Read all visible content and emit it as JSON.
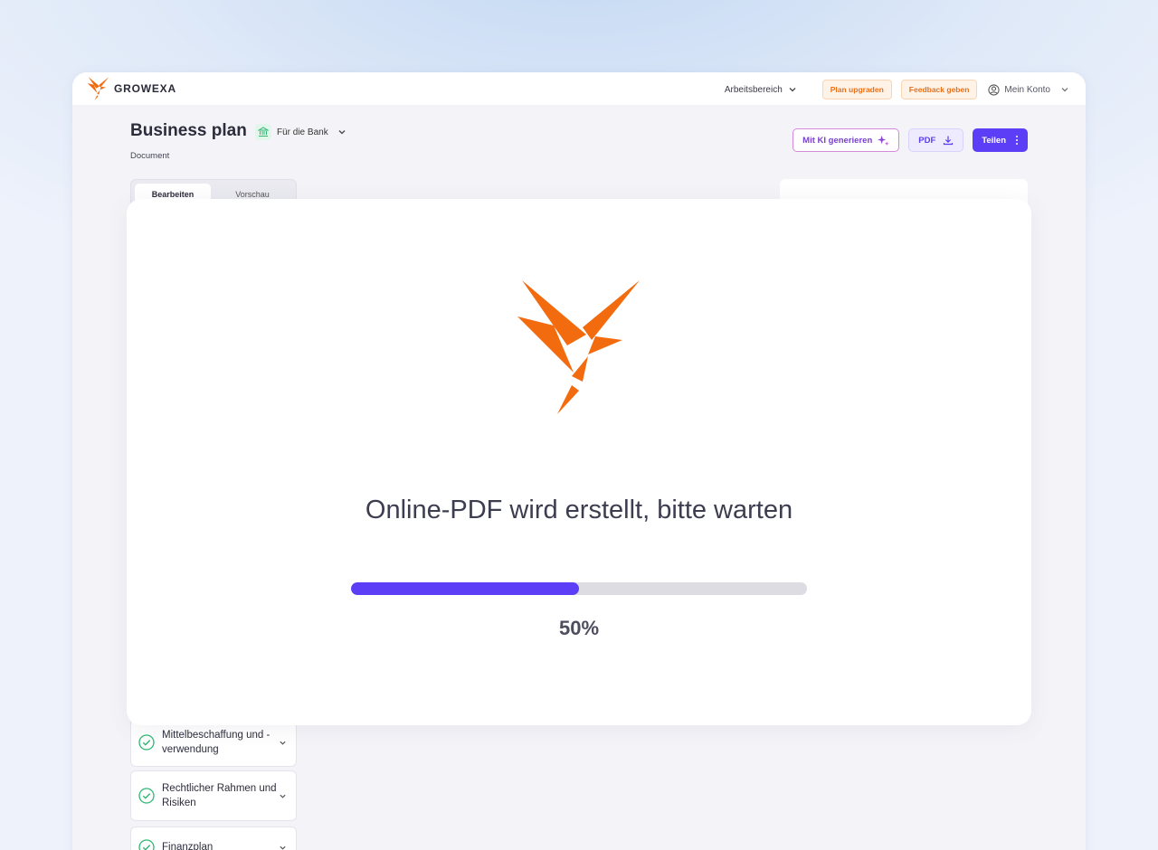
{
  "brand": {
    "name": "GROWEXA",
    "color": "#f26b0f"
  },
  "topbar": {
    "workspace": "Arbeitsbereich",
    "upgrade": "Plan upgraden",
    "feedback": "Feedback geben",
    "account": "Mein Konto"
  },
  "header": {
    "title": "Business plan",
    "audience": "Für die Bank",
    "subtitle": "Document"
  },
  "actions": {
    "ai": "Mit KI generieren",
    "pdf": "PDF",
    "share": "Teilen"
  },
  "tabs": [
    "Bearbeiten",
    "Vorschau"
  ],
  "sections": [
    {
      "label": "Mittelbeschaffung und -verwendung",
      "done": true
    },
    {
      "label": "Rechtlicher Rahmen und Risiken",
      "done": true
    },
    {
      "label": "Finanzplan",
      "done": true
    }
  ],
  "modal": {
    "message": "Online-PDF wird erstellt, bitte warten",
    "progress": 0.5,
    "progress_label": "50%"
  },
  "colors": {
    "accent": "#5b3ef5",
    "orange": "#f26b0f",
    "success": "#2fb873"
  },
  "icons": {
    "workspace_chevron": "chevron-down-icon",
    "account": "user-circle-icon",
    "bank": "bank-icon",
    "ai": "sparkles-icon",
    "pdf": "download-icon",
    "share_more": "more-vertical-icon",
    "section_status": "check-circle-icon"
  }
}
